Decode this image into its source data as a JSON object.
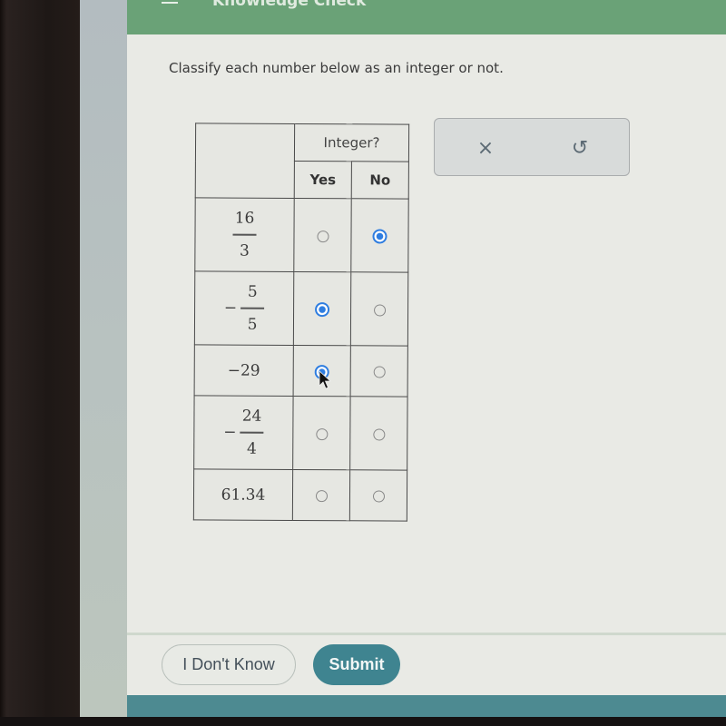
{
  "header": {
    "menu_icon": "hamburger-icon",
    "title": "Knowledge Check"
  },
  "question": {
    "prompt": "Classify each number below as an integer or not."
  },
  "table": {
    "group_header": "Integer?",
    "columns": [
      "Yes",
      "No"
    ],
    "rows": [
      {
        "type": "fraction",
        "sign": "",
        "numerator": "16",
        "denominator": "3",
        "selected": "No"
      },
      {
        "type": "fraction",
        "sign": "−",
        "numerator": "5",
        "denominator": "5",
        "selected": "Yes"
      },
      {
        "type": "number",
        "label": "−29",
        "selected": "Yes"
      },
      {
        "type": "fraction",
        "sign": "−",
        "numerator": "24",
        "denominator": "4",
        "selected": null
      },
      {
        "type": "number",
        "label": "61.34",
        "selected": null
      }
    ]
  },
  "tools": {
    "clear_icon": "close-icon",
    "clear_glyph": "×",
    "undo_icon": "undo-icon",
    "undo_glyph": "↺"
  },
  "footer": {
    "dont_know_label": "I Don't Know",
    "submit_label": "Submit"
  },
  "colors": {
    "header_green": "#6aa277",
    "radio_selected": "#2e7de0",
    "submit_bg": "#3f8490"
  }
}
